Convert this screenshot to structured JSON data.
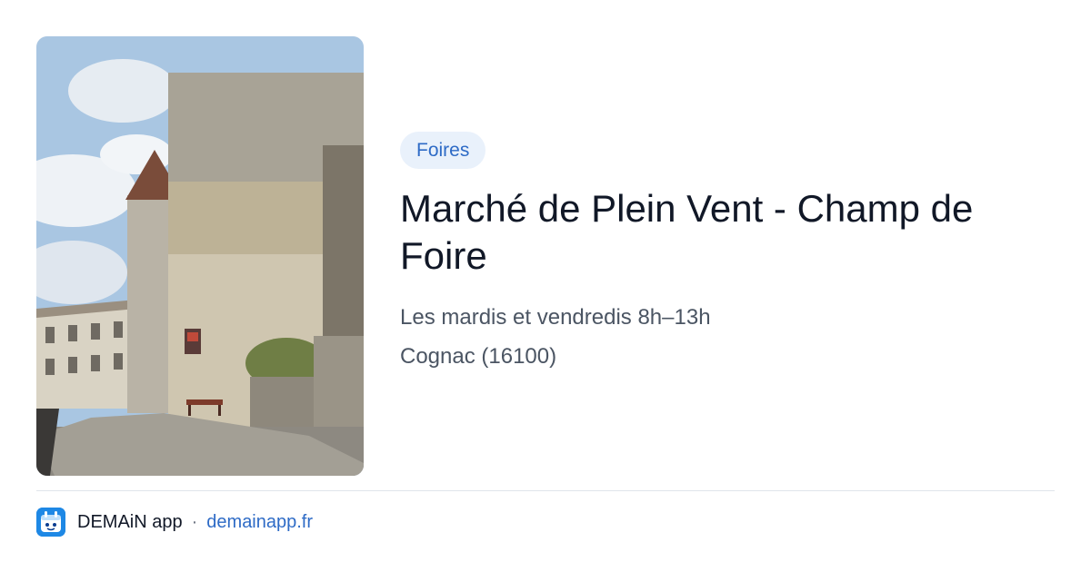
{
  "card": {
    "image_alt": "Château de Cognac stone walls and cobbled street",
    "category": "Foires",
    "title": "Marché de Plein Vent - Champ de Foire",
    "schedule": "Les mardis et vendredis 8h–13h",
    "location": "Cognac (16100)"
  },
  "footer": {
    "app_icon": "demain-app-icon",
    "brand": "DEMAiN app",
    "separator": "·",
    "site": "demainapp.fr"
  },
  "colors": {
    "badge_bg": "#e9f1fb",
    "accent": "#2e6bc6",
    "app_icon_bg": "#1e88e5"
  }
}
